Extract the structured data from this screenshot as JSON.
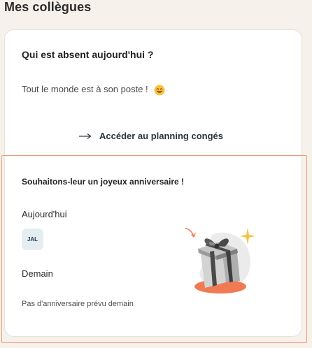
{
  "section": {
    "title": "Mes collègues"
  },
  "absences": {
    "title": "Qui est absent aujourd'hui ?",
    "message": "Tout le monde est à son poste !",
    "emoji_icon": "smiley-face-icon"
  },
  "planning_link": {
    "label": "Accéder au planning congés",
    "icon": "arrow-right-icon"
  },
  "birthdays": {
    "title": "Souhaitons-leur un joyeux anniversaire !",
    "today_label": "Aujourd'hui",
    "today_avatar": "JAL",
    "tomorrow_label": "Demain",
    "tomorrow_message": "Pas d'anniversaire prévu demain",
    "illustration": "gift-box-illustration"
  },
  "colors": {
    "highlight_border": "#ef9a7a",
    "accent_orange": "#f07a53",
    "sparkle_yellow": "#f1c34a"
  }
}
